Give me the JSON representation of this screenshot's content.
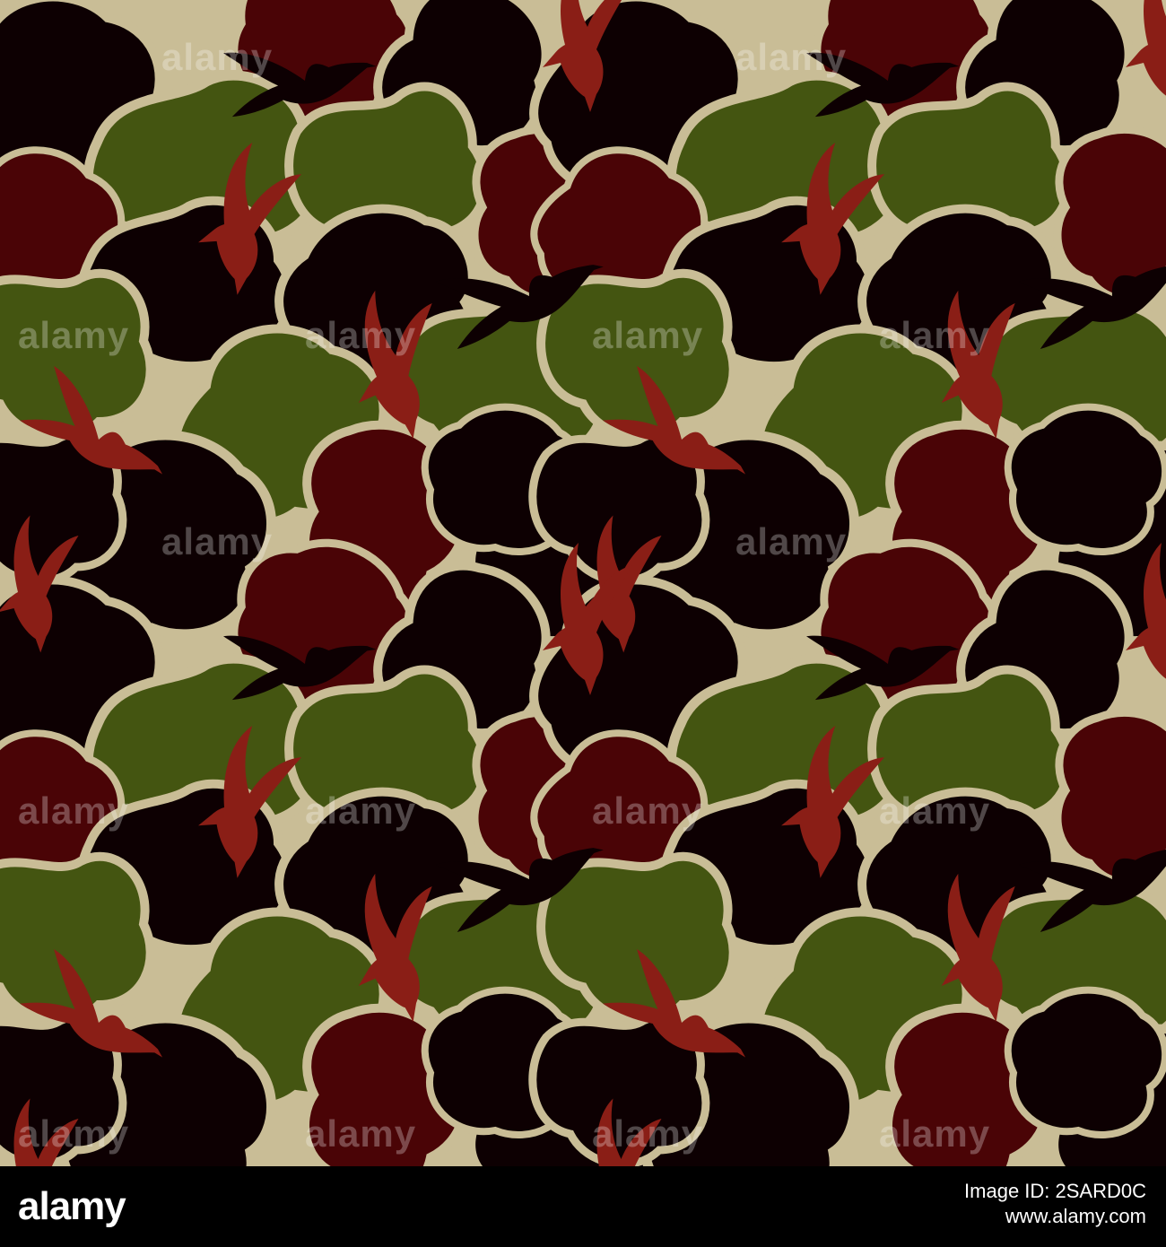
{
  "pattern": {
    "subject": "duck camouflage seamless pattern",
    "colors": {
      "background": "#c9bd96",
      "green": "#445511",
      "red": "#4a0406",
      "dark": "#0d0002",
      "birdRed": "#8a1e16"
    }
  },
  "watermark": {
    "text": "alamy"
  },
  "footer": {
    "brand": "alamy",
    "image_id_line": "Image ID: 2SARD0C",
    "url": "www.alamy.com"
  }
}
